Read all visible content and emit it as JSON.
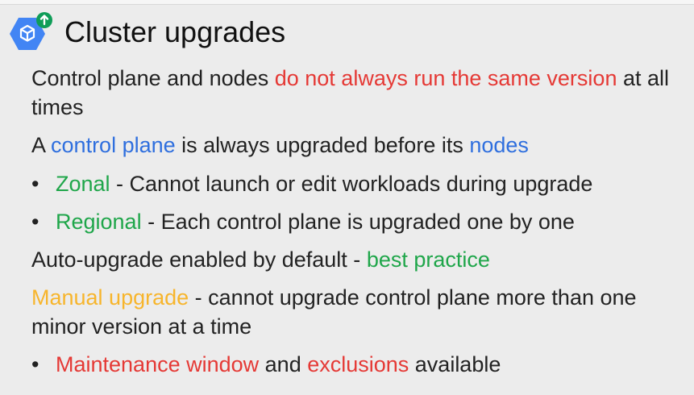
{
  "slide": {
    "title": "Cluster upgrades",
    "logo_icon": "gke-hexagon-icon",
    "badge_icon": "arrow-up-icon"
  },
  "lines": {
    "line1": {
      "part1": "Control plane and nodes ",
      "highlight": "do not always run the same version",
      "part2": " at all times"
    },
    "line2": {
      "part1": "A ",
      "highlight1": "control plane",
      "part2": " is always upgraded before its ",
      "highlight2": "nodes"
    },
    "bullet1": {
      "dot": "•",
      "highlight": "Zonal",
      "rest": " - Cannot launch or edit workloads during upgrade"
    },
    "bullet2": {
      "dot": "•",
      "highlight": "Regional",
      "rest": " - Each control plane is upgraded one by one"
    },
    "line3": {
      "part1": "Auto-upgrade enabled by default - ",
      "highlight": "best practice"
    },
    "line4": {
      "highlight": "Manual upgrade",
      "rest": " - cannot upgrade control plane more than one minor version at a time"
    },
    "bullet3": {
      "dot": "•",
      "highlight1": "Maintenance window",
      "middle": " and ",
      "highlight2": "exclusions",
      "rest": " available"
    }
  },
  "colors": {
    "red": "#e53935",
    "blue": "#2f6fde",
    "green": "#1fa64a",
    "yellow": "#f7b52c",
    "logo_blue": "#4285f4",
    "badge_green": "#0f9d58"
  }
}
